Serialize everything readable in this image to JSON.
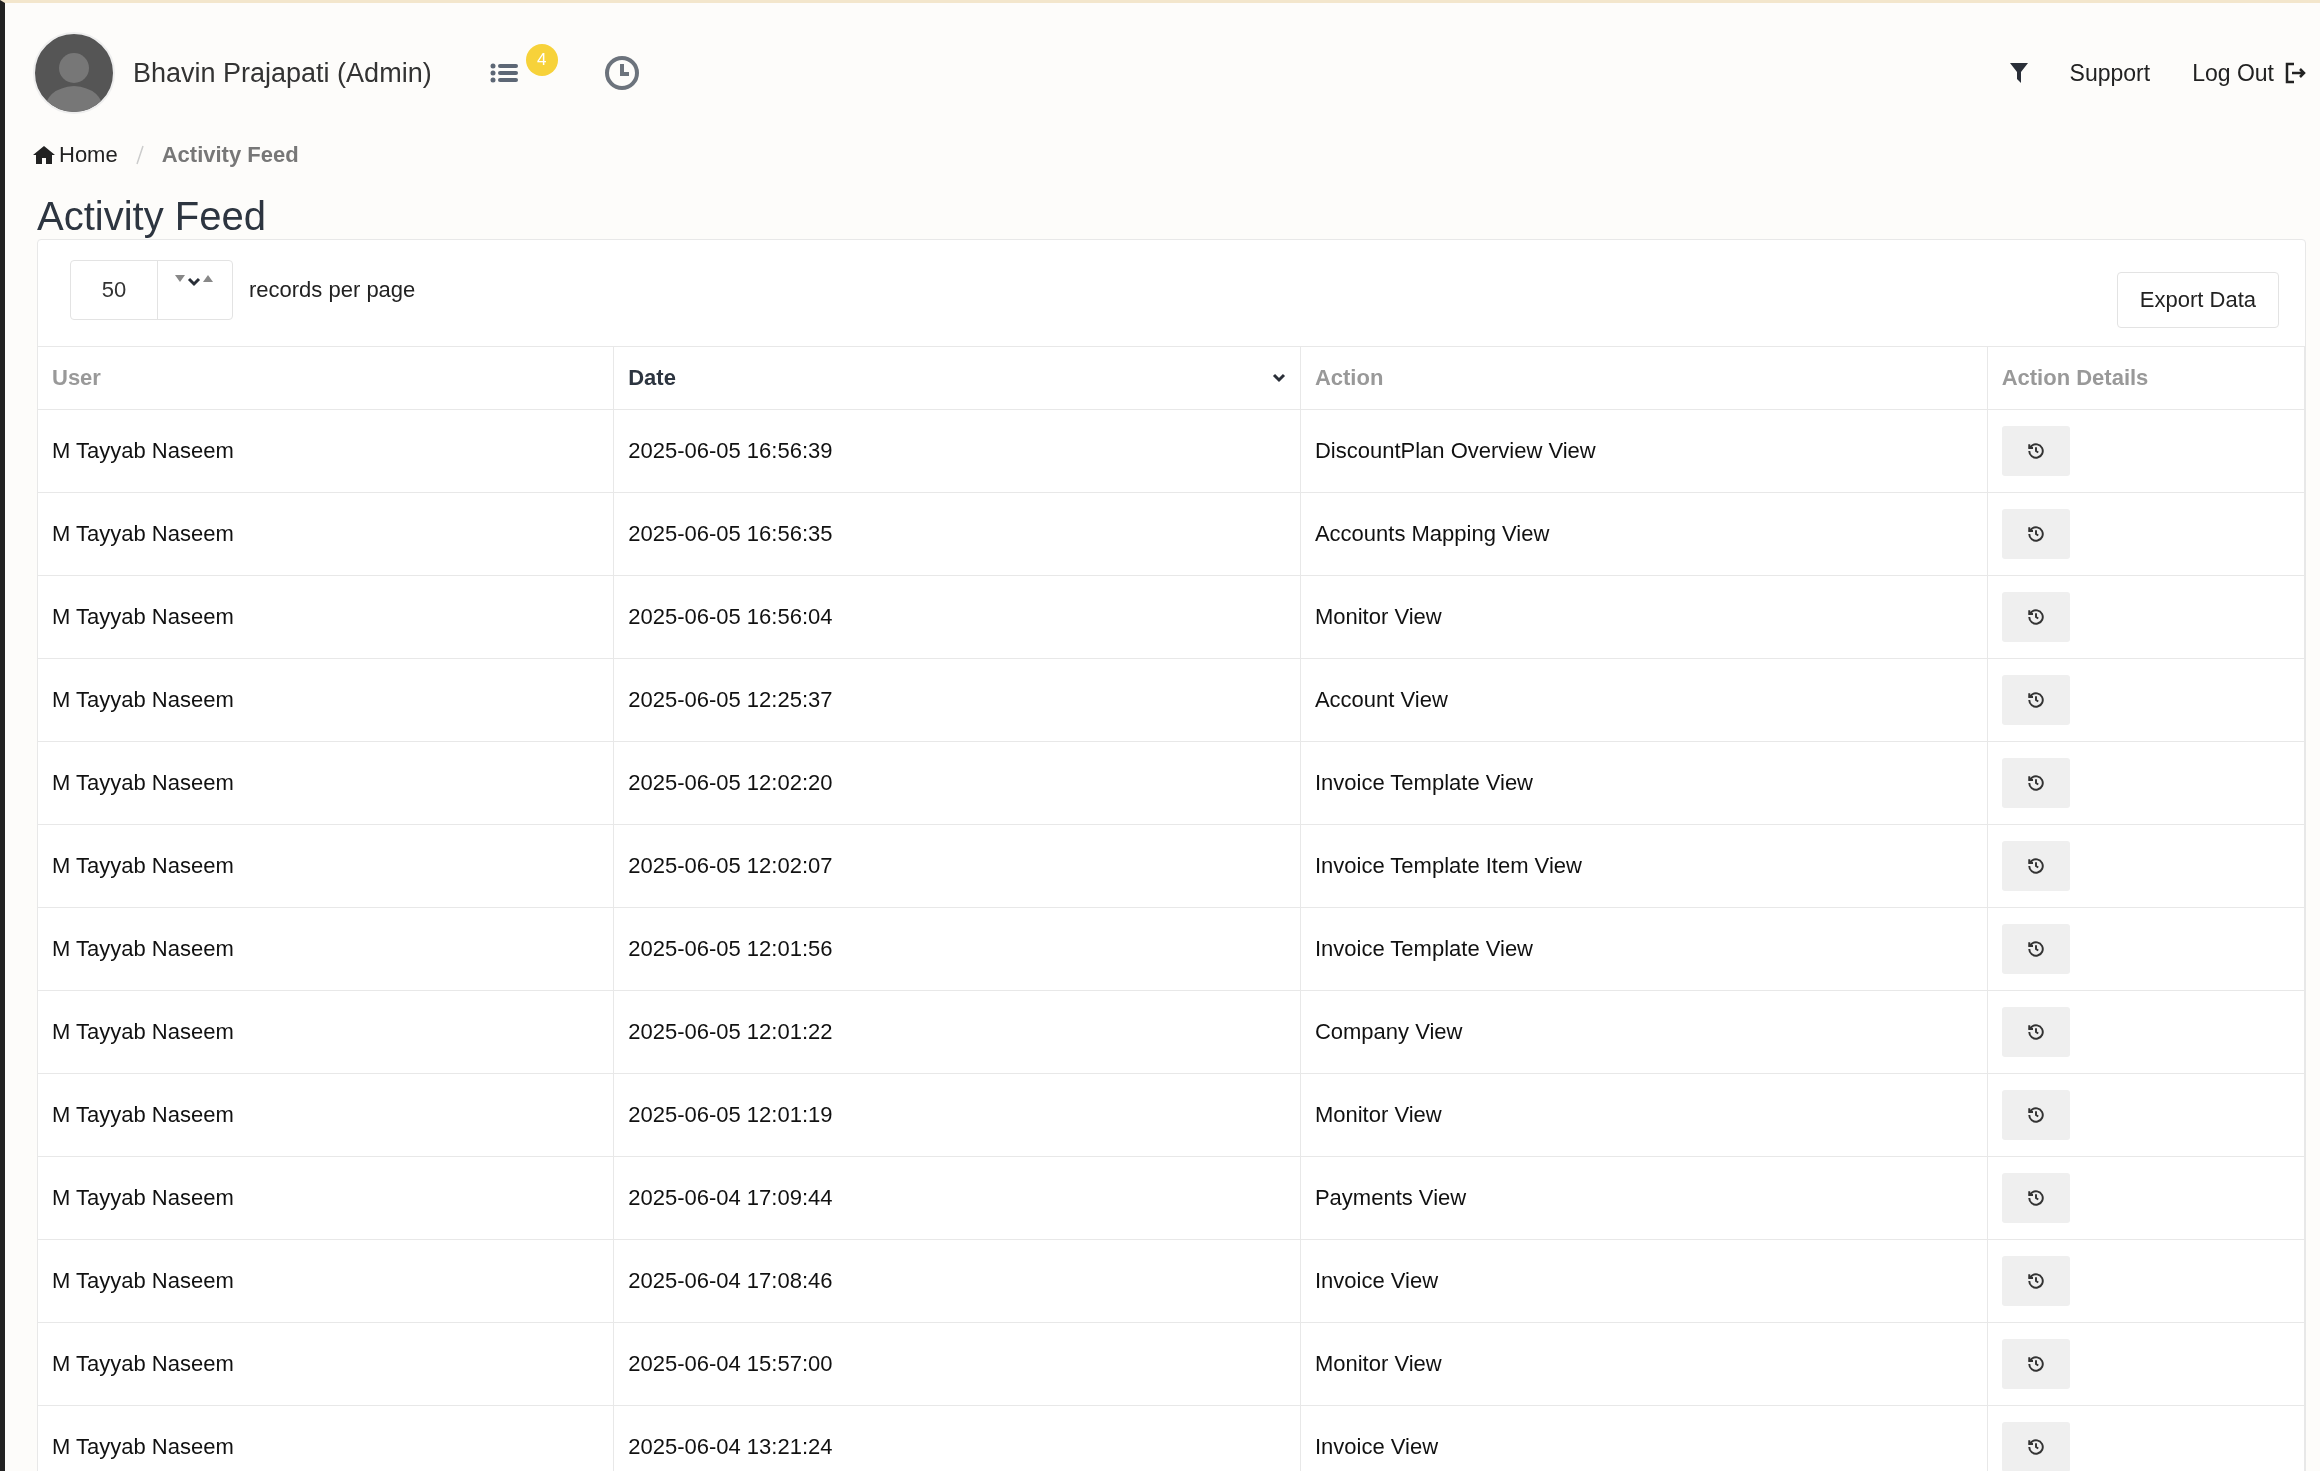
{
  "header": {
    "user_name": "Bhavin Prajapati (Admin)",
    "notification_count": "4",
    "links": [
      "Support",
      "Log Out"
    ]
  },
  "breadcrumb": [
    {
      "label": "Home",
      "current": false
    },
    {
      "label": "Activity Feed",
      "current": true
    }
  ],
  "page_title": "Activity Feed",
  "toolbar": {
    "page_size": "50",
    "page_size_label": "records per page",
    "export_button": "Export Data"
  },
  "table": {
    "columns": [
      {
        "label": "User",
        "sorted": false
      },
      {
        "label": "Date",
        "sorted": true
      },
      {
        "label": "Action",
        "sorted": false
      },
      {
        "label": "Action Details",
        "sorted": false
      }
    ],
    "rows": [
      {
        "user": "M Tayyab Naseem",
        "date": "2025-06-05 16:56:39",
        "action": "DiscountPlan Overview View"
      },
      {
        "user": "M Tayyab Naseem",
        "date": "2025-06-05 16:56:35",
        "action": "Accounts Mapping View"
      },
      {
        "user": "M Tayyab Naseem",
        "date": "2025-06-05 16:56:04",
        "action": "Monitor View"
      },
      {
        "user": "M Tayyab Naseem",
        "date": "2025-06-05 12:25:37",
        "action": "Account View"
      },
      {
        "user": "M Tayyab Naseem",
        "date": "2025-06-05 12:02:20",
        "action": "Invoice Template View"
      },
      {
        "user": "M Tayyab Naseem",
        "date": "2025-06-05 12:02:07",
        "action": "Invoice Template Item View"
      },
      {
        "user": "M Tayyab Naseem",
        "date": "2025-06-05 12:01:56",
        "action": "Invoice Template View"
      },
      {
        "user": "M Tayyab Naseem",
        "date": "2025-06-05 12:01:22",
        "action": "Company View"
      },
      {
        "user": "M Tayyab Naseem",
        "date": "2025-06-05 12:01:19",
        "action": "Monitor View"
      },
      {
        "user": "M Tayyab Naseem",
        "date": "2025-06-04 17:09:44",
        "action": "Payments View"
      },
      {
        "user": "M Tayyab Naseem",
        "date": "2025-06-04 17:08:46",
        "action": "Invoice View"
      },
      {
        "user": "M Tayyab Naseem",
        "date": "2025-06-04 15:57:00",
        "action": "Monitor View"
      },
      {
        "user": "M Tayyab Naseem",
        "date": "2025-06-04 13:21:24",
        "action": "Invoice View"
      }
    ]
  }
}
